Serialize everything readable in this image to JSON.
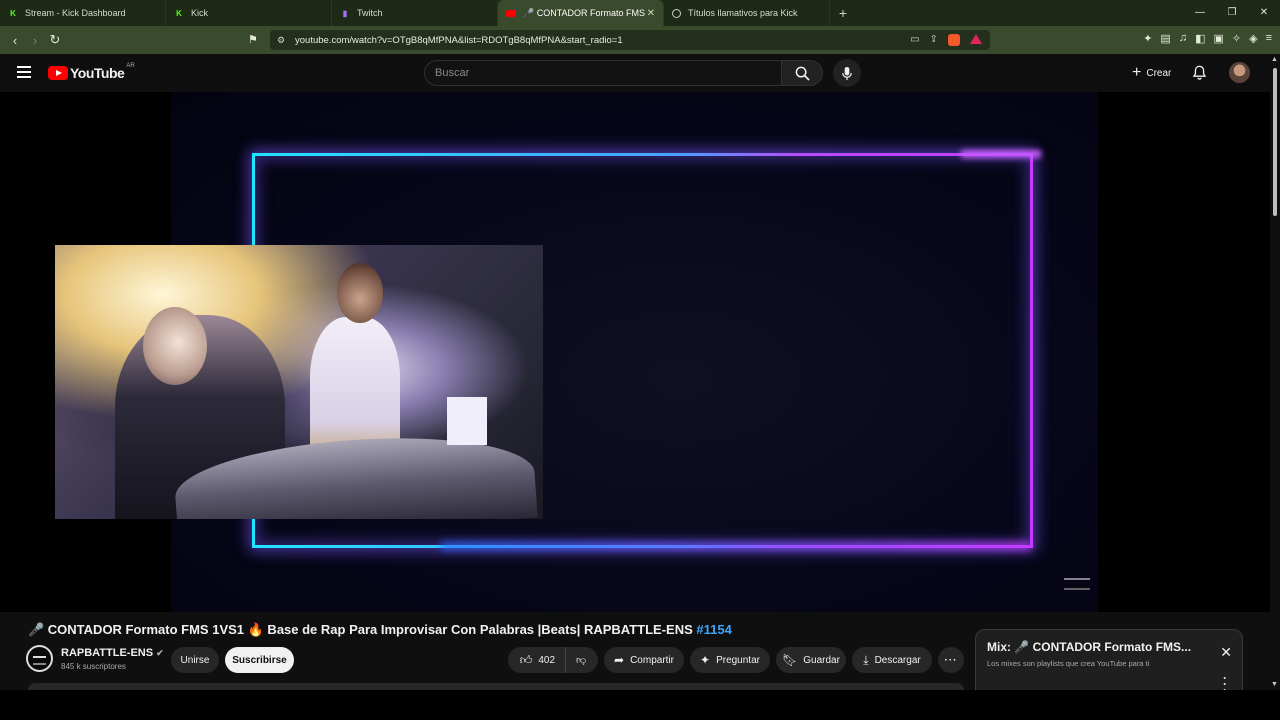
{
  "browser": {
    "tabs": [
      {
        "label": "Stream - Kick Dashboard",
        "icon": "kick-icon"
      },
      {
        "label": "Kick",
        "icon": "kick-icon"
      },
      {
        "label": "Twitch",
        "icon": "twitch-icon"
      },
      {
        "label": "🎤 CONTADOR Formato FMS",
        "icon": "youtube-icon",
        "active": true
      },
      {
        "label": "Títulos llamativos para Kick",
        "icon": "chatgpt-icon"
      }
    ],
    "new_tab": "+",
    "url": "youtube.com/watch?v=OTgB8qMfPNA&list=RDOTgB8qMfPNA&start_radio=1",
    "window_controls": [
      "—",
      "❐",
      "✕"
    ]
  },
  "youtube": {
    "logo_text": "YouTube",
    "region": "AR",
    "search_placeholder": "Buscar",
    "create_label": "Crear"
  },
  "video": {
    "title_prefix": "🎤 CONTADOR Formato FMS 1VS1 🔥 Base de Rap Para Improvisar Con Palabras |Beats| RAPBATTLE-ENS ",
    "title_hashtag": "#1154",
    "channel_name": "RAPBATTLE-ENS",
    "subscribers": "845 k suscriptores",
    "join_label": "Unirse",
    "subscribe_label": "Suscribirse",
    "likes": "402",
    "share_label": "Compartir",
    "ask_label": "Preguntar",
    "save_label": "Guardar",
    "download_label": "Descargar"
  },
  "mix": {
    "title": "Mix: 🎤 CONTADOR Formato FMS...",
    "subtitle": "Los mixes son playlists que crea YouTube para ti"
  },
  "colors": {
    "browser_frame": "#1f2a16",
    "accent_link": "#3ea6ff",
    "neon_cyan": "#22e3ff",
    "neon_purple": "#c63bff"
  }
}
